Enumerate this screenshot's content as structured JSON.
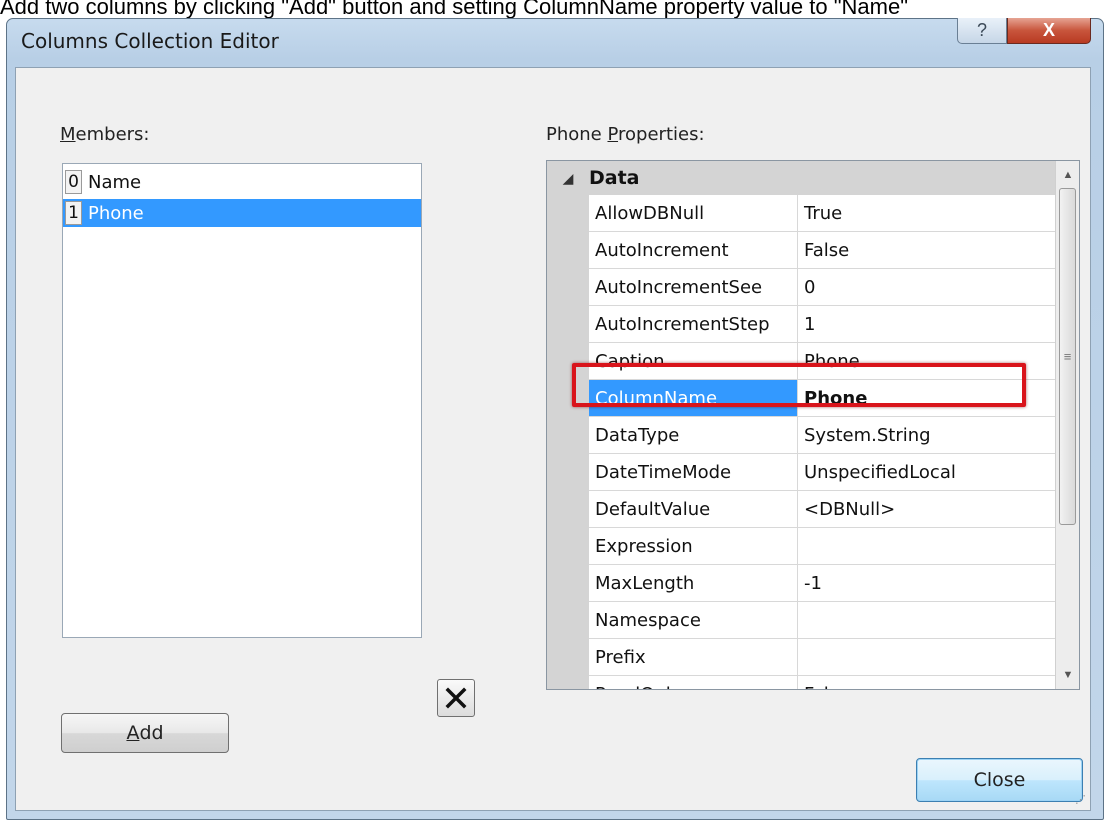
{
  "caption": "Add two columns by clicking \"Add\" button and setting ColumnName property value to \"Name\"",
  "window": {
    "title": "Columns Collection Editor",
    "help_glyph": "?",
    "close_glyph": "X"
  },
  "members": {
    "label_first": "M",
    "label_rest": "embers:",
    "items": [
      {
        "index": "0",
        "name": "Name",
        "selected": false
      },
      {
        "index": "1",
        "name": "Phone",
        "selected": true
      }
    ]
  },
  "buttons": {
    "delete_glyph": "✕",
    "add_first": "A",
    "add_rest": "dd",
    "close": "Close"
  },
  "properties": {
    "label_pre": "Phone ",
    "label_mnemonic": "P",
    "label_rest": "roperties:",
    "category": {
      "toggle": "◢",
      "name": "Data"
    },
    "rows": [
      {
        "name": "AllowDBNull",
        "value": "True"
      },
      {
        "name": "AutoIncrement",
        "value": "False"
      },
      {
        "name": "AutoIncrementSee",
        "value": "0"
      },
      {
        "name": "AutoIncrementStep",
        "value": "1"
      },
      {
        "name": "Caption",
        "value": "Phone"
      },
      {
        "name": "ColumnName",
        "value": "Phone",
        "selected": true
      },
      {
        "name": "DataType",
        "value": "System.String"
      },
      {
        "name": "DateTimeMode",
        "value": "UnspecifiedLocal"
      },
      {
        "name": "DefaultValue",
        "value": "<DBNull>"
      },
      {
        "name": "Expression",
        "value": ""
      },
      {
        "name": "MaxLength",
        "value": "-1"
      },
      {
        "name": "Namespace",
        "value": ""
      },
      {
        "name": "Prefix",
        "value": ""
      },
      {
        "name": "ReadOnly",
        "value": "False"
      }
    ]
  },
  "scrollbar": {
    "up": "▲",
    "down": "▼",
    "grip": "≡"
  },
  "colors": {
    "selection": "#3399ff",
    "highlight": "#d9141b",
    "close_button": "#c8553c"
  }
}
